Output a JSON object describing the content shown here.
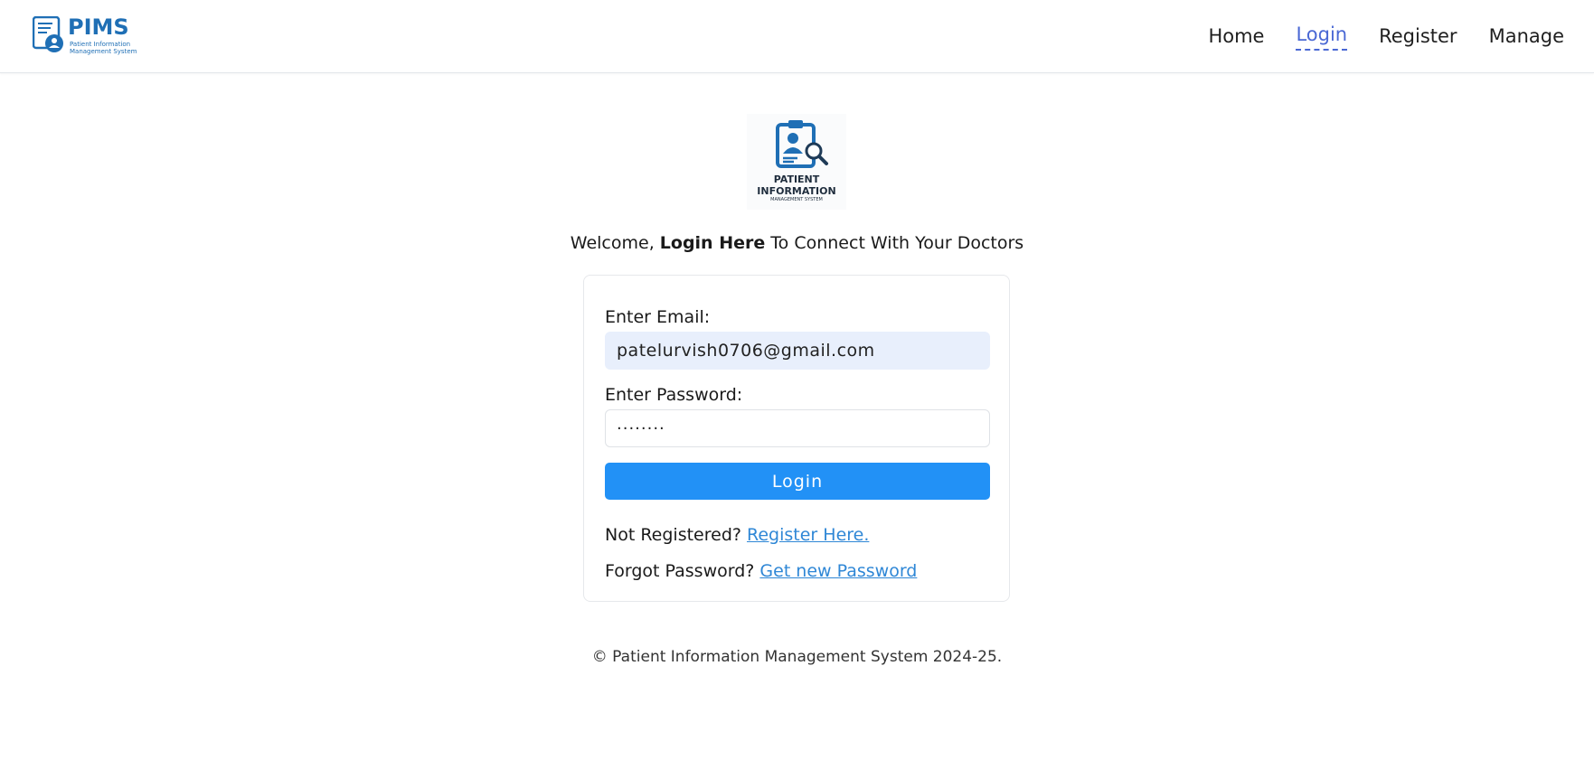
{
  "brand": {
    "logo_text": "PIMS",
    "logo_subtext_line1": "Patient Information",
    "logo_subtext_line2": "Management System"
  },
  "nav": {
    "items": [
      {
        "label": "Home",
        "active": false
      },
      {
        "label": "Login",
        "active": true
      },
      {
        "label": "Register",
        "active": false
      },
      {
        "label": "Manage",
        "active": false
      }
    ]
  },
  "hero_logo": {
    "line1": "PATIENT",
    "line2": "INFORMATION",
    "line3": "MANAGEMENT SYSTEM"
  },
  "welcome": {
    "prefix": "Welcome, ",
    "bold": "Login Here",
    "suffix": " To Connect With Your Doctors"
  },
  "form": {
    "email_label": "Enter Email:",
    "email_value": "patelurvish0706@gmail.com",
    "password_label": "Enter Password:",
    "password_value": "········",
    "login_button": "Login",
    "not_registered_text": "Not Registered? ",
    "register_link": "Register Here.",
    "forgot_text": "Forgot Password? ",
    "forgot_link": "Get new Password"
  },
  "footer": {
    "text": "© Patient Information Management System 2024-25."
  },
  "colors": {
    "accent": "#2291f6",
    "link": "#2f87d6",
    "nav_active": "#4a68d4",
    "brand_blue": "#1f6fb5"
  }
}
